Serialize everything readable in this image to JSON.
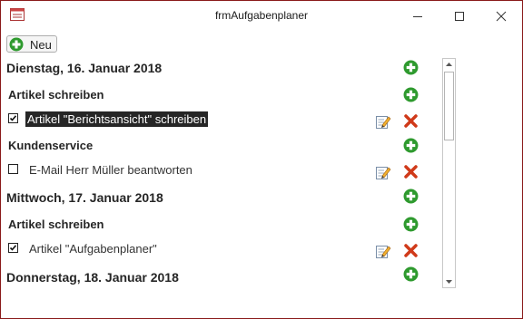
{
  "window": {
    "title": "frmAufgabenplaner"
  },
  "toolbar": {
    "new_label": "Neu"
  },
  "days": [
    {
      "date": "Dienstag, 16. Januar 2018",
      "categories": [
        {
          "name": "Artikel schreiben",
          "tasks": [
            {
              "text": "Artikel \"Berichtsansicht\" schreiben",
              "done": true,
              "selected": true
            }
          ]
        },
        {
          "name": "Kundenservice",
          "tasks": [
            {
              "text": "E-Mail Herr Müller beantworten",
              "done": false,
              "selected": false
            }
          ]
        }
      ]
    },
    {
      "date": "Mittwoch, 17. Januar 2018",
      "categories": [
        {
          "name": "Artikel schreiben",
          "tasks": [
            {
              "text": "Artikel \"Aufgabenplaner\"",
              "done": true,
              "selected": false
            }
          ]
        }
      ]
    },
    {
      "date": "Donnerstag, 18. Januar 2018",
      "categories": []
    }
  ],
  "icons": {
    "add": "add-circle-icon",
    "edit": "edit-pencil-icon",
    "delete": "delete-x-icon",
    "checked": "checkmark-icon"
  },
  "colors": {
    "border": "#8a1a1a",
    "add_green": "#2e9a2e",
    "delete_red": "#d03a1a",
    "selected_bg": "#262626"
  }
}
